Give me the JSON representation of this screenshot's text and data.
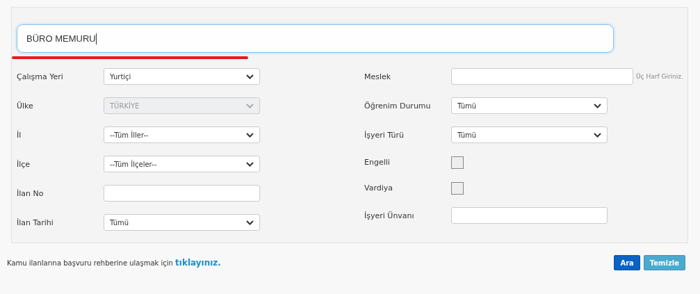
{
  "search": {
    "value": "BÜRO MEMURU"
  },
  "left_fields": [
    {
      "label": "Çalışma Yeri",
      "kind": "select",
      "value": "Yurtiçi",
      "disabled": false
    },
    {
      "label": "Ülke",
      "kind": "select",
      "value": "TÜRKİYE",
      "disabled": true
    },
    {
      "label": "İl",
      "kind": "select",
      "value": "--Tüm İller--",
      "disabled": false
    },
    {
      "label": "İlçe",
      "kind": "select",
      "value": "--Tüm İlçeler--",
      "disabled": false
    },
    {
      "label": "İlan No",
      "kind": "text"
    },
    {
      "label": "İlan Tarihi",
      "kind": "select",
      "value": "Tümü",
      "disabled": false
    }
  ],
  "right_fields": [
    {
      "label": "Meslek",
      "kind": "text",
      "hint": "Üç Harf Giriniz."
    },
    {
      "label": "Öğrenim Durumu",
      "kind": "select",
      "value": "Tümü",
      "disabled": false
    },
    {
      "label": "İşyeri Türü",
      "kind": "select",
      "value": "Tümü",
      "disabled": false
    },
    {
      "label": "Engelli",
      "kind": "checkbox",
      "checked": false
    },
    {
      "label": "Vardiya",
      "kind": "checkbox",
      "checked": false
    },
    {
      "label": "İşyeri Ünvanı",
      "kind": "text"
    }
  ],
  "footer": {
    "text": "Kamu ilanlarına başvuru rehberine ulaşmak için",
    "link": "tıklayınız."
  },
  "buttons": [
    {
      "label": "Ara",
      "kind": "primary"
    },
    {
      "label": "Temizle",
      "kind": "secondary"
    }
  ]
}
